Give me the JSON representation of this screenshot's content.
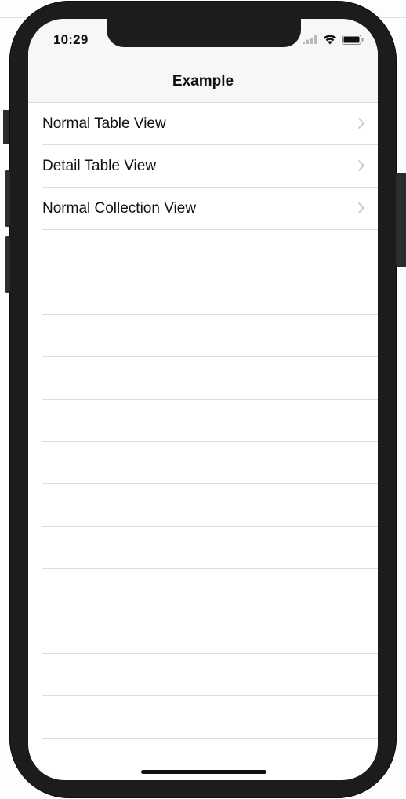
{
  "status_bar": {
    "time": "10:29"
  },
  "nav": {
    "title": "Example"
  },
  "rows": [
    {
      "label": "Normal Table View"
    },
    {
      "label": "Detail Table View"
    },
    {
      "label": "Normal Collection View"
    }
  ],
  "empty_row_count": 13,
  "icons": {
    "signal": "cellular-signal-icon",
    "wifi": "wifi-icon",
    "battery": "battery-icon",
    "disclosure": "chevron-right-icon"
  },
  "colors": {
    "device_frame": "#1c1c1c",
    "bar_background": "#f7f7f7",
    "separator": "#dcdcdc",
    "chevron": "#c4c4c7",
    "text": "#111111"
  }
}
